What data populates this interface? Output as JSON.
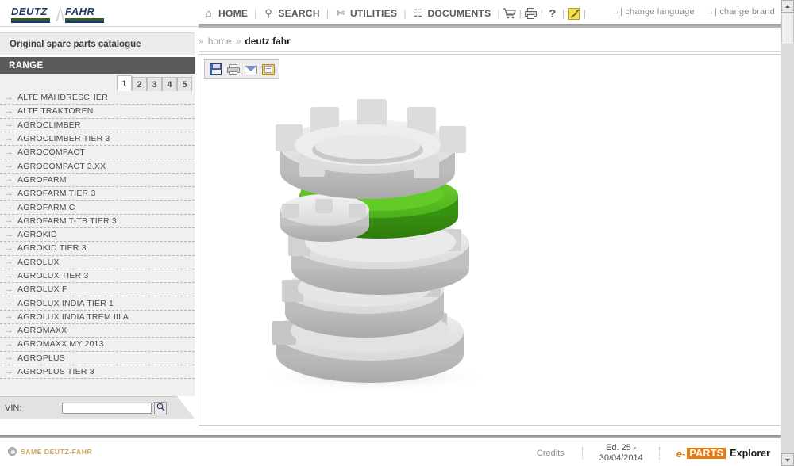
{
  "header": {
    "logo": {
      "word1": "DEUTZ",
      "word2": "FAHR"
    },
    "nav": [
      {
        "label": "HOME",
        "icon": "home-icon",
        "glyph": "⌂"
      },
      {
        "label": "SEARCH",
        "icon": "search-icon",
        "glyph": "⚲"
      },
      {
        "label": "UTILITIES",
        "icon": "tools-icon",
        "glyph": "✄"
      },
      {
        "label": "DOCUMENTS",
        "icon": "documents-icon",
        "glyph": "☷"
      }
    ],
    "separator": "|",
    "icon_buttons": [
      {
        "name": "cart-icon",
        "glyph": "Ὥ2"
      },
      {
        "name": "printer-icon",
        "glyph": "⎙"
      },
      {
        "name": "help-icon",
        "glyph": "?"
      },
      {
        "name": "notes-icon",
        "glyph": ""
      }
    ],
    "links": [
      {
        "arrow": "→|",
        "label": "change language"
      },
      {
        "arrow": "→|",
        "label": "change brand"
      }
    ]
  },
  "subtitle": "Original spare parts catalogue",
  "breadcrumb": {
    "sep": "»",
    "items": [
      {
        "label": "home",
        "current": false
      },
      {
        "label": "deutz fahr",
        "current": true
      }
    ]
  },
  "sidebar": {
    "section_title": "RANGE",
    "pages": [
      "1",
      "2",
      "3",
      "4",
      "5"
    ],
    "active_page": "1",
    "arrow": "→",
    "items": [
      {
        "label": "ALTE MÄHDRESCHER"
      },
      {
        "label": "ALTE TRAKTOREN"
      },
      {
        "label": "AGROCLIMBER"
      },
      {
        "label": "AGROCLIMBER TIER 3"
      },
      {
        "label": "AGROCOMPACT"
      },
      {
        "label": "AGROCOMPACT 3.XX"
      },
      {
        "label": "AGROFARM"
      },
      {
        "label": "AGROFARM TIER 3"
      },
      {
        "label": "AGROFARM C"
      },
      {
        "label": "AGROFARM T-TB TIER 3"
      },
      {
        "label": "AGROKID"
      },
      {
        "label": "AGROKID TIER 3"
      },
      {
        "label": "AGROLUX"
      },
      {
        "label": "AGROLUX TIER 3"
      },
      {
        "label": "AGROLUX F"
      },
      {
        "label": "AGROLUX INDIA TIER 1"
      },
      {
        "label": "AGROLUX INDIA TREM III A"
      },
      {
        "label": "AGROMAXX"
      },
      {
        "label": "AGROMAXX MY 2013"
      },
      {
        "label": "AGROPLUS"
      },
      {
        "label": "AGROPLUS TIER 3"
      }
    ],
    "vin": {
      "label": "VIN:",
      "value": "",
      "placeholder": "",
      "search_glyph": "⌕"
    }
  },
  "main": {
    "toolbar": [
      {
        "name": "save-icon",
        "title": "Save"
      },
      {
        "name": "print-icon",
        "title": "Print"
      },
      {
        "name": "email-icon",
        "title": "Email"
      },
      {
        "name": "export-icon",
        "title": "Export"
      }
    ],
    "illustration": {
      "name": "gear-stack-illustration",
      "description": "3D stack of gray gears with one highlighted green gear",
      "gear_color": "#d8d8d8",
      "highlight_color": "#4caf21"
    }
  },
  "footer": {
    "brand": "SAME DEUTZ-FAHR",
    "credits": "Credits",
    "edition_line1": "Ed. 25 -",
    "edition_line2": "30/04/2014",
    "product": {
      "e": "e-",
      "parts": "PARTS",
      "explorer": "Explorer"
    }
  },
  "colors": {
    "brand_blue": "#1f3864",
    "brand_green": "#2e5d2e",
    "accent_orange": "#e87b10",
    "range_header": "#595959",
    "highlight_green": "#4caf21"
  }
}
